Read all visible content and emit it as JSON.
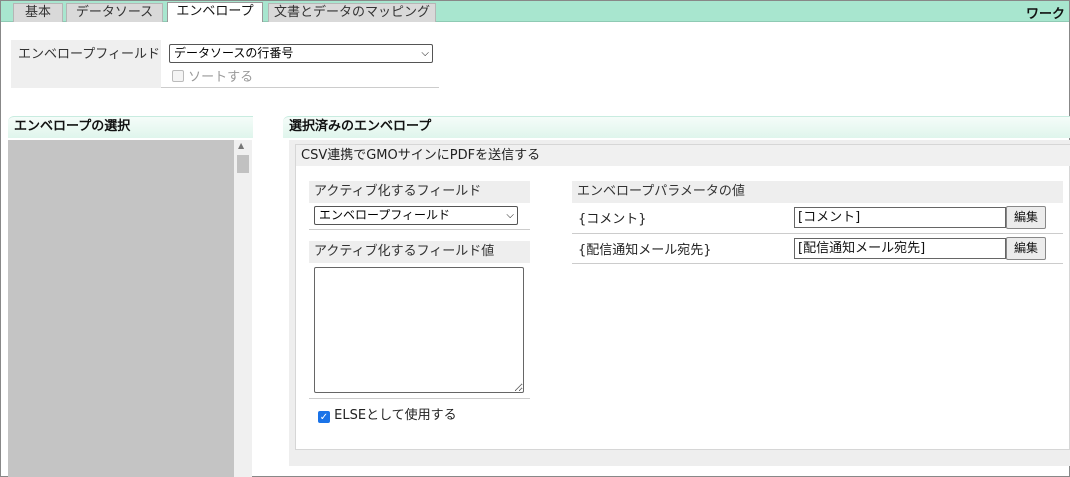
{
  "tabs": [
    {
      "label": "基本",
      "active": false
    },
    {
      "label": "データソース",
      "active": false
    },
    {
      "label": "エンベロープ",
      "active": true
    },
    {
      "label": "文書とデータのマッピング",
      "active": false
    }
  ],
  "window_title": "ワーク",
  "envelope_field": {
    "label": "エンベロープフィールド",
    "selected": "データソースの行番号",
    "sort_label": "ソートする",
    "sort_checked": false
  },
  "left_section": {
    "title": "エンベロープの選択"
  },
  "right_section": {
    "title": "選択済みのエンベロープ",
    "envelope_name": "CSV連携でGMOサインにPDFを送信する",
    "activate_field": {
      "header": "アクティブ化するフィールド",
      "selected": "エンベロープフィールド"
    },
    "activate_value": {
      "header": "アクティブ化するフィールド値",
      "value": ""
    },
    "else_label": "ELSEとして使用する",
    "else_checked": true,
    "params": {
      "header": "エンベロープパラメータの値",
      "edit_label": "編集",
      "rows": [
        {
          "name": "{コメント}",
          "value": "[コメント]"
        },
        {
          "name": "{配信通知メール宛先}",
          "value": "[配信通知メール宛先]"
        }
      ]
    }
  },
  "colors": {
    "tabbar": "#a8e6cf",
    "list_bg": "#c4c4c4",
    "checkbox_accent": "#1a73e8"
  }
}
